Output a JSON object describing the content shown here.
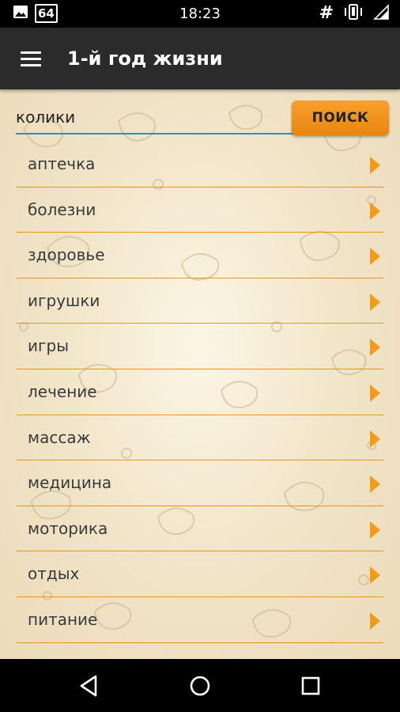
{
  "status_bar": {
    "time": "18:23",
    "badge": "64",
    "hash_symbol": "#"
  },
  "app_bar": {
    "title": "1-й год жизни"
  },
  "search": {
    "value": "колики",
    "button_label": "ПОИСК"
  },
  "colors": {
    "accent": "#f29a1a",
    "app_bar": "#2b2b2b",
    "input_underline": "#2b8fc9",
    "divider": "#e8921c"
  },
  "list": {
    "items": [
      {
        "label": "аптечка"
      },
      {
        "label": "болезни"
      },
      {
        "label": "здоровье"
      },
      {
        "label": "игрушки"
      },
      {
        "label": "игры"
      },
      {
        "label": "лечение"
      },
      {
        "label": "массаж"
      },
      {
        "label": "медицина"
      },
      {
        "label": "моторика"
      },
      {
        "label": "отдых"
      },
      {
        "label": "питание"
      }
    ]
  },
  "icons": {
    "image": "image-icon",
    "vibrate": "vibrate-icon",
    "signal": "signal-icon",
    "menu": "menu-icon",
    "chevron": "chevron-right-icon",
    "back": "back-icon",
    "home": "home-icon",
    "recents": "recents-icon"
  }
}
